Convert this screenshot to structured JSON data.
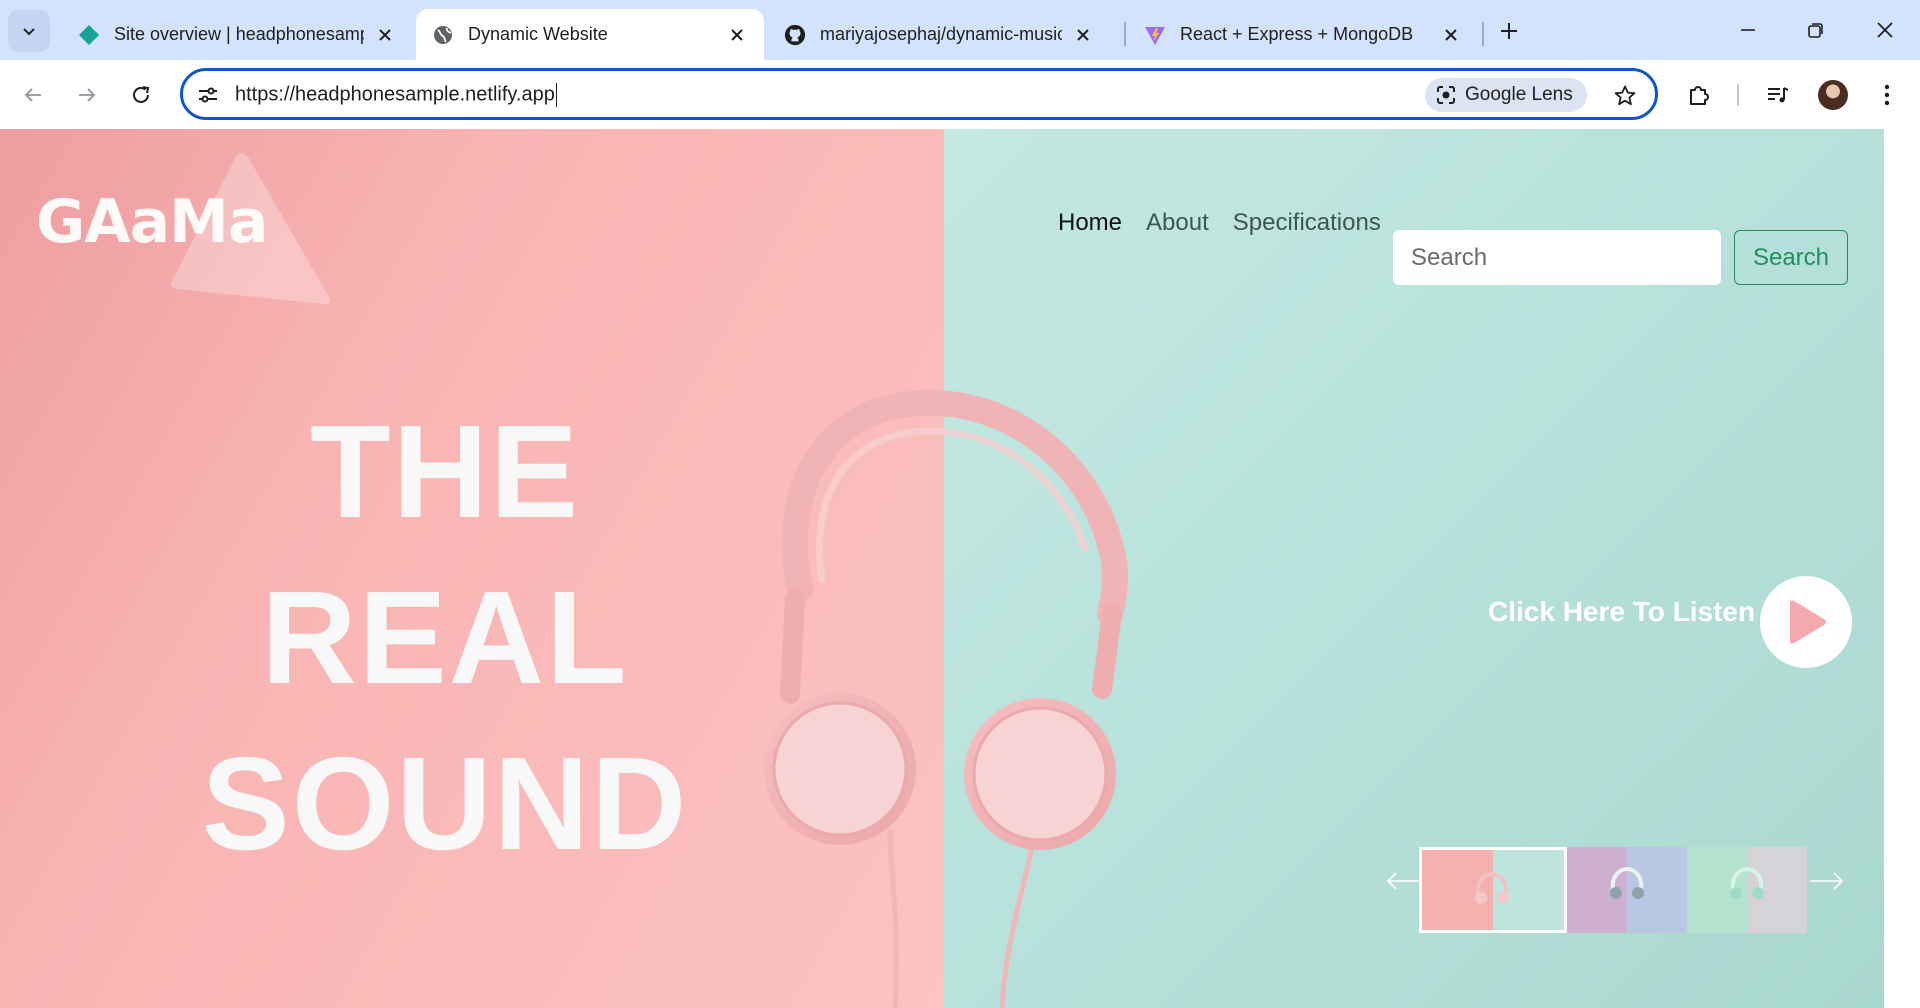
{
  "browser": {
    "tabs": [
      {
        "title": "Site overview | headphonesample",
        "favicon": "netlify-diamond-icon",
        "active": false
      },
      {
        "title": "Dynamic Website",
        "favicon": "globe-icon",
        "active": true
      },
      {
        "title": "mariyajosephaj/dynamic-music",
        "favicon": "github-icon",
        "active": false
      },
      {
        "title": "React + Express + MongoDB",
        "favicon": "vite-icon",
        "active": false
      }
    ],
    "url": "https://headphonesample.netlify.app",
    "lens_label": "Google Lens",
    "colors": {
      "tabstrip": "#d3e3fd",
      "focus_ring": "#0b57d0"
    }
  },
  "site": {
    "logo": "GAaMa",
    "nav": [
      {
        "label": "Home",
        "active": true
      },
      {
        "label": "About",
        "active": false
      },
      {
        "label": "Specifications",
        "active": false
      }
    ],
    "search": {
      "placeholder": "Search",
      "button_label": "Search"
    },
    "headline": [
      "THE",
      "REAL",
      "SOUND"
    ],
    "cta": "Click Here To Listen",
    "carousel": {
      "active_index": 0,
      "thumbnails": [
        {
          "left": "#f5b1b0",
          "right": "#bde5de"
        },
        {
          "left": "#cdb0cf",
          "right": "#b8c8e2"
        },
        {
          "left": "#b4e3cf",
          "right": "#d5d3d7"
        }
      ]
    },
    "colors": {
      "pink": "#f8b4b3",
      "mint": "#b8e2db",
      "accent_green": "#1f8f5d",
      "play_triangle": "#f3a9ad"
    }
  }
}
